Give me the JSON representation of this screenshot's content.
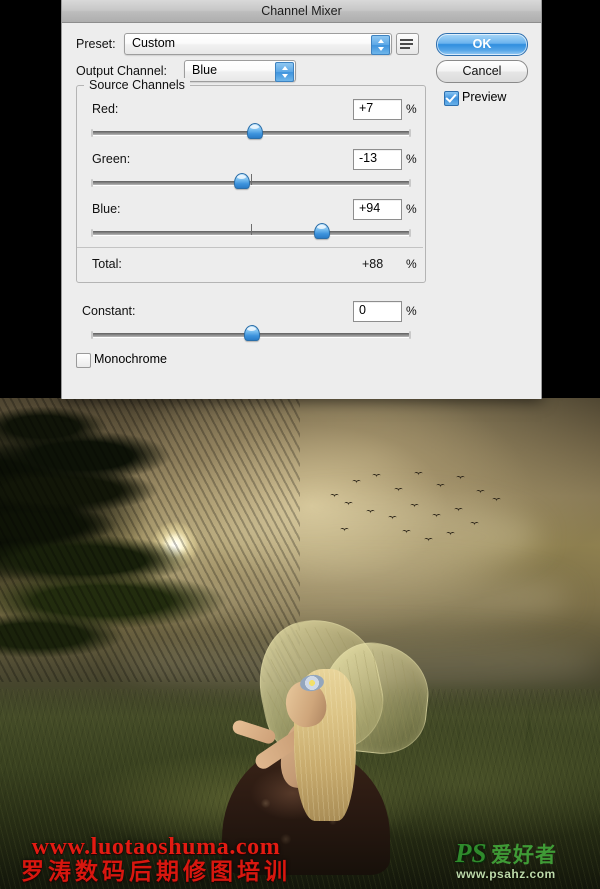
{
  "dialog": {
    "title": "Channel Mixer",
    "preset": {
      "label": "Preset:",
      "value": "Custom",
      "options_icon": "preset-options-icon"
    },
    "output_channel": {
      "label": "Output Channel:",
      "value": "Blue"
    },
    "buttons": {
      "ok": "OK",
      "cancel": "Cancel"
    },
    "preview": {
      "label": "Preview",
      "checked": true
    },
    "source_channels": {
      "legend": "Source Channels",
      "percent_symbol": "%",
      "channels": [
        {
          "label": "Red:",
          "value": "+7",
          "slider_percent": 51,
          "origin_percent": 50
        },
        {
          "label": "Green:",
          "value": "-13",
          "slider_percent": 47,
          "origin_percent": 50
        },
        {
          "label": "Blue:",
          "value": "+94",
          "slider_percent": 72,
          "origin_percent": 50
        }
      ],
      "total": {
        "label": "Total:",
        "value": "+88"
      }
    },
    "constant": {
      "label": "Constant:",
      "value": "0",
      "slider_percent": 50,
      "percent_symbol": "%"
    },
    "monochrome": {
      "label": "Monochrome",
      "checked": false
    }
  },
  "artwork": {
    "description": "Fantasy forest scene at dusk with a blonde winged fairy kneeling on mossy ground, glowing orb among misty conifers and a flock of birds",
    "watermark_left": {
      "url": "www.luotaoshuma.com",
      "chinese": "罗涛数码后期修图培训",
      "color": "#e21b12"
    },
    "watermark_right": {
      "brand_latin": "PS",
      "brand_chinese": "爱好者",
      "url": "www.psahz.com",
      "color": "#2f8a2c"
    }
  }
}
